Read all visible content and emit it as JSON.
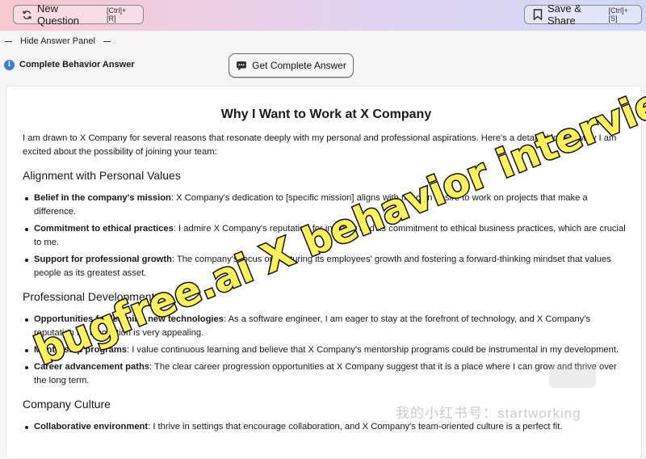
{
  "toolbar": {
    "new_question_label": "New Question",
    "new_question_shortcut": "[Ctrl]+[R]",
    "save_share_label": "Save & Share",
    "save_share_shortcut": "[Ctrl]+[S]"
  },
  "panel": {
    "toggle_label": "Hide Answer Panel"
  },
  "answer": {
    "section_title": "Complete Behavior Answer",
    "get_button_label": "Get Complete Answer"
  },
  "doc": {
    "title": "Why I Want to Work at X Company",
    "intro": "I am drawn to X Company for several reasons that resonate deeply with my personal and professional aspirations. Here's a detailed look at why I am excited about the possibility of joining your team:",
    "sections": [
      {
        "heading": "Alignment with Personal Values",
        "items": [
          {
            "bold": "Belief in the company's mission",
            "text": ": X Company's dedication to [specific mission] aligns with my own desire to work on projects that make a difference."
          },
          {
            "bold": "Commitment to ethical practices",
            "text": ": I admire X Company's reputation for integrity and its commitment to ethical business practices, which are crucial to me."
          },
          {
            "bold": "Support for professional growth",
            "text": ": The company's focus on nurturing its employees' growth and fostering a forward-thinking mindset that values people as its greatest asset."
          }
        ]
      },
      {
        "heading": "Professional Development",
        "items": [
          {
            "bold": "Opportunities for learning new technologies",
            "text": ": As a software engineer, I am eager to stay at the forefront of technology, and X Company's reputation for innovation is very appealing."
          },
          {
            "bold": "Mentorship programs",
            "text": ": I value continuous learning and believe that X Company's mentorship programs could be instrumental in my development."
          },
          {
            "bold": "Career advancement paths",
            "text": ": The clear career progression opportunities at X Company suggest that it is a place where I can grow and thrive over the long term."
          }
        ]
      },
      {
        "heading": "Company Culture",
        "items": [
          {
            "bold": "Collaborative environment",
            "text": ": I thrive in settings that encourage collaboration, and X Company's team-oriented culture is a perfect fit."
          }
        ]
      }
    ]
  },
  "overlay": {
    "line1": "bugfree.ai X behavior interview",
    "watermark": "我的小红书号：startworking"
  },
  "colors": {
    "overlay_fill": "#fff15a",
    "info_icon": "#3b7ddd"
  },
  "icons": [
    "refresh-icon",
    "bookmark-icon",
    "info-icon",
    "chat-icon"
  ]
}
